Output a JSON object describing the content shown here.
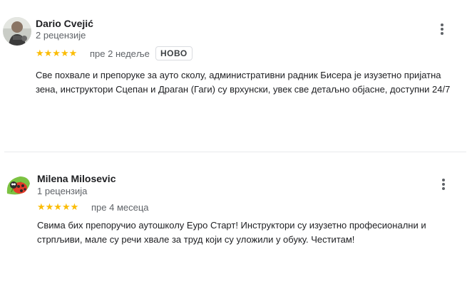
{
  "reviews": [
    {
      "author": "Dario Cvejić",
      "review_count": "2 рецензије",
      "rating_stars": "★★★★★",
      "rating": 5,
      "date": "пре 2 недеље",
      "badge": "НОВО",
      "text": "Све похвале и препоруке за ауто сколу, административни радник Бисера је изузетно пријатна зена, инструктори Сцепан и Драган (Гаги) су врхунски, увек све детаљно објасне, доступни 24/7",
      "avatar_icon": "person-photo-avatar"
    },
    {
      "author": "Milena Milosevic",
      "review_count": "1 рецензија",
      "rating_stars": "★★★★★",
      "rating": 5,
      "date": "пре 4 месеца",
      "text": "Свима бих препоручио аутошколу Еуро Старт! Инструктори су изузетно професионални и стрпљиви, мале су речи хвале за труд који су уложили у обуку. Честитам!",
      "avatar_icon": "ladybug-avatar"
    }
  ],
  "colors": {
    "star": "#fbbc04",
    "secondary_text": "#5f6368",
    "primary_text": "#202124"
  }
}
